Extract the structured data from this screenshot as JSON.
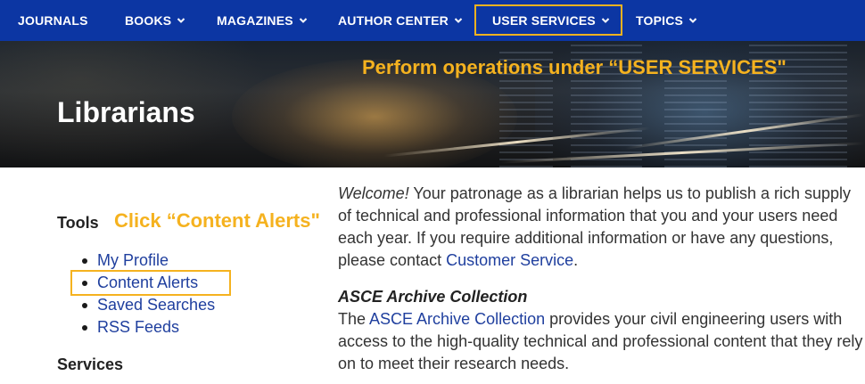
{
  "nav": {
    "items": [
      {
        "label": "JOURNALS",
        "has_dropdown": false
      },
      {
        "label": "BOOKS",
        "has_dropdown": true
      },
      {
        "label": "MAGAZINES",
        "has_dropdown": true
      },
      {
        "label": "AUTHOR CENTER",
        "has_dropdown": true
      },
      {
        "label": "USER SERVICES",
        "has_dropdown": true
      },
      {
        "label": "TOPICS",
        "has_dropdown": true
      }
    ],
    "background": "#0c36a3",
    "highlighted": "USER SERVICES"
  },
  "hero": {
    "title": "Librarians",
    "annotation": "Perform operations under “USER SERVICES\""
  },
  "sidebar": {
    "tools_heading": "Tools",
    "annotation": "Click “Content Alerts\"",
    "tools": [
      {
        "label": "My Profile"
      },
      {
        "label": "Content Alerts",
        "highlighted": true
      },
      {
        "label": "Saved Searches"
      },
      {
        "label": "RSS Feeds"
      }
    ],
    "services_heading": "Services"
  },
  "main": {
    "welcome": "Welcome!",
    "intro": " Your patronage as a librarian helps us to publish a rich supply of technical and professional information that you and your users need each year. If you require additional information or have any questions, please contact ",
    "contact_link": "Customer Service",
    "intro_end": ".",
    "archive_heading": "ASCE Archive Collection",
    "archive_pre": "The ",
    "archive_link": "ASCE Archive Collection",
    "archive_post": " provides your civil engineering users with access to the high-quality technical and professional content that they rely on to meet their research needs."
  },
  "colors": {
    "accent_annotation": "#f5b21f",
    "link": "#1f3f9e"
  }
}
